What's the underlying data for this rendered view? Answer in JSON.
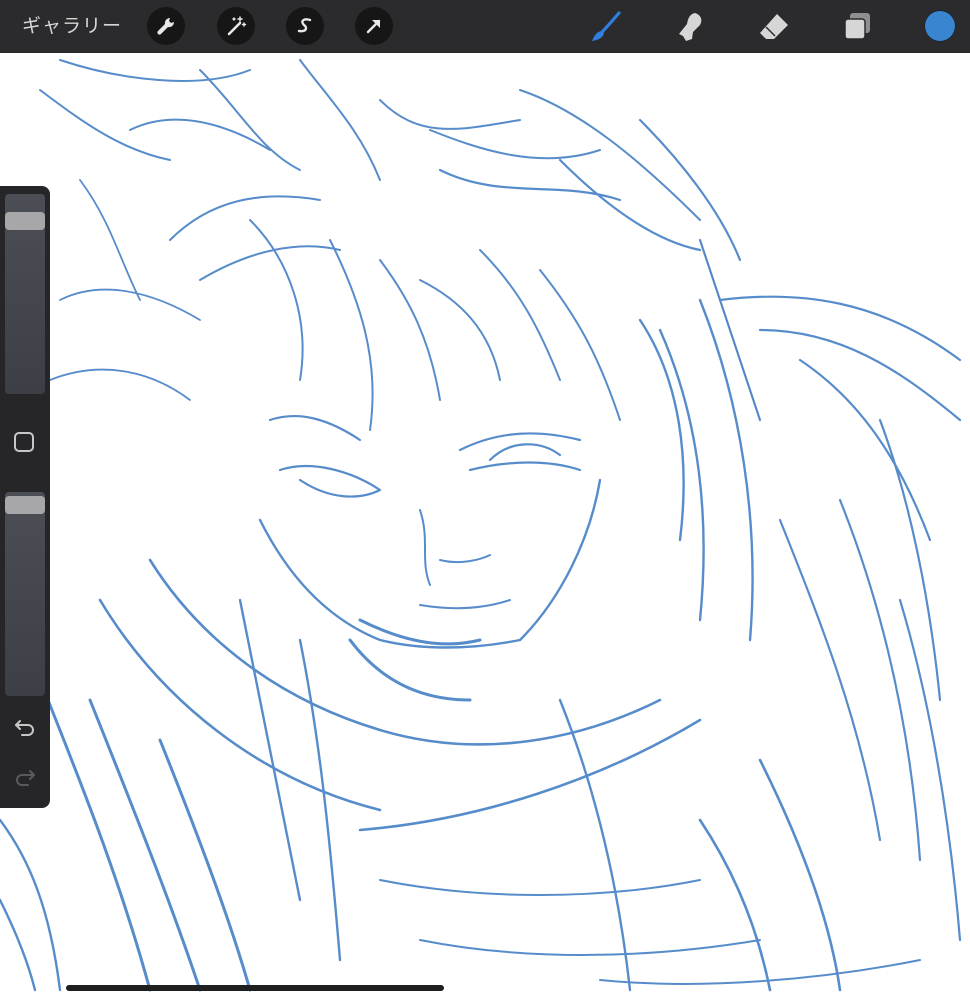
{
  "toolbar": {
    "gallery_label": "ギャラリー",
    "left_tools": [
      {
        "name": "wrench-icon",
        "meaning": "actions"
      },
      {
        "name": "magic-wand-icon",
        "meaning": "adjustments"
      },
      {
        "name": "selection-s-icon",
        "meaning": "selection"
      },
      {
        "name": "arrow-icon",
        "meaning": "transform"
      }
    ],
    "right_tools": [
      {
        "name": "brush-icon",
        "meaning": "paint",
        "active": true
      },
      {
        "name": "smudge-icon",
        "meaning": "smudge"
      },
      {
        "name": "eraser-icon",
        "meaning": "erase"
      },
      {
        "name": "layers-icon",
        "meaning": "layers"
      }
    ],
    "active_color": "#3a85d0",
    "active_tool_color": "#2f7fe0"
  },
  "sidebar": {
    "brush_size_level": 0.9,
    "opacity_level": 0.98,
    "icons": [
      "square-icon",
      "undo-icon",
      "redo-icon"
    ]
  },
  "canvas": {
    "background": "#ffffff",
    "stroke_color": "#3a78c2"
  }
}
